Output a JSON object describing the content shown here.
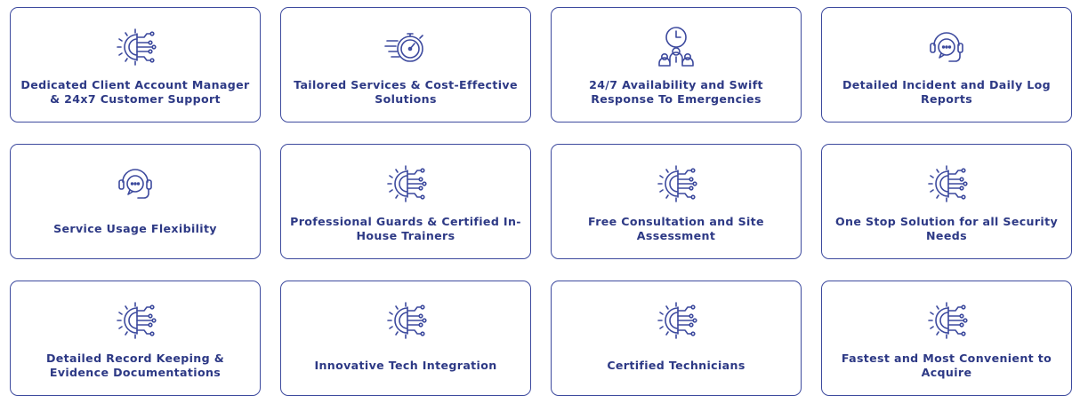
{
  "colors": {
    "accent": "#3d4a9e",
    "text": "#2d3985"
  },
  "cards": [
    {
      "label": "Dedicated Client Account Manager & 24x7 Customer Support",
      "icon": "circuit-gear-icon"
    },
    {
      "label": "Tailored Services & Cost-Effective Solutions",
      "icon": "stopwatch-speed-icon"
    },
    {
      "label": "24/7 Availability and Swift Response To Emergencies",
      "icon": "clock-team-icon"
    },
    {
      "label": "Detailed Incident and Daily Log Reports",
      "icon": "headset-chat-icon"
    },
    {
      "label": "Service Usage Flexibility",
      "icon": "headset-chat-icon"
    },
    {
      "label": "Professional Guards & Certified In-House Trainers",
      "icon": "circuit-gear-icon"
    },
    {
      "label": "Free Consultation and Site Assessment",
      "icon": "circuit-gear-icon"
    },
    {
      "label": "One Stop Solution for all Security Needs",
      "icon": "circuit-gear-icon"
    },
    {
      "label": "Detailed Record Keeping & Evidence Documentations",
      "icon": "circuit-gear-icon"
    },
    {
      "label": "Innovative Tech Integration",
      "icon": "circuit-gear-icon"
    },
    {
      "label": "Certified Technicians",
      "icon": "circuit-gear-icon"
    },
    {
      "label": "Fastest and Most Convenient to Acquire",
      "icon": "circuit-gear-icon"
    }
  ]
}
